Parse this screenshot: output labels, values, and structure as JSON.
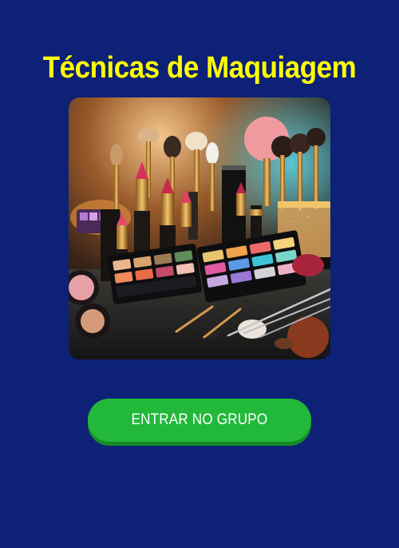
{
  "page": {
    "title": "Técnicas de Maquiagem",
    "background_color": "#0d2177",
    "title_color": "#ffff00"
  },
  "hero_image": {
    "alt": "makeup products: brushes, lipsticks and eyeshadow palettes"
  },
  "cta": {
    "label": "ENTRAR NO GRUPO",
    "color": "#22b83a"
  }
}
